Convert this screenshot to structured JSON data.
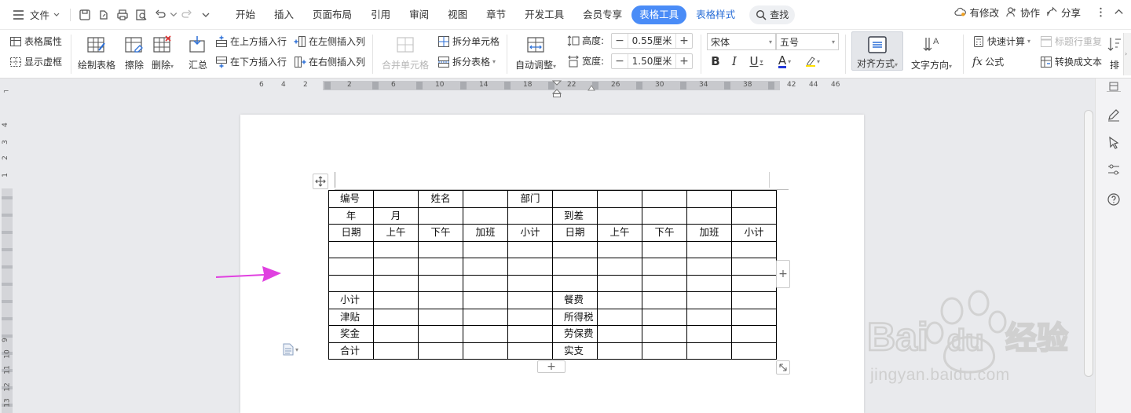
{
  "menubar": {
    "file_label": "文件",
    "tabs": [
      {
        "label": "开始"
      },
      {
        "label": "插入"
      },
      {
        "label": "页面布局"
      },
      {
        "label": "引用"
      },
      {
        "label": "审阅"
      },
      {
        "label": "视图"
      },
      {
        "label": "章节"
      },
      {
        "label": "开发工具"
      },
      {
        "label": "会员专享"
      },
      {
        "label": "表格工具",
        "active": true
      },
      {
        "label": "表格样式"
      }
    ],
    "search_label": "查找",
    "modified_label": "有修改",
    "collab_label": "协作",
    "share_label": "分享"
  },
  "ribbon": {
    "table_props": "表格属性",
    "show_gridlines": "显示虚框",
    "draw_table": "绘制表格",
    "erase": "擦除",
    "delete": "删除",
    "summary": "汇总",
    "insert_row_above": "在上方插入行",
    "insert_row_below": "在下方插入行",
    "insert_col_left": "在左侧插入列",
    "insert_col_right": "在右侧插入列",
    "merge_cells": "合并单元格",
    "split_cells": "拆分单元格",
    "split_table": "拆分表格",
    "auto_fit": "自动调整",
    "height_label": "高度:",
    "height_value": "0.55厘米",
    "width_label": "宽度:",
    "width_value": "1.50厘米",
    "font_name": "宋体",
    "font_size": "五号",
    "align": "对齐方式",
    "text_direction": "文字方向",
    "quick_calc": "快速计算",
    "repeat_header": "标题行重复",
    "formula": "公式",
    "convert_to_text": "转换成文本",
    "more": "排"
  },
  "ruler": {
    "h_numbers": [
      "6",
      "4",
      "2",
      "2",
      "6",
      "10",
      "14",
      "18",
      "22",
      "26",
      "30",
      "34",
      "38",
      "42",
      "44",
      "46"
    ],
    "v_numbers": [
      "4",
      "3",
      "2",
      "1",
      "1",
      "2",
      "9",
      "10",
      "11",
      "12",
      "13"
    ]
  },
  "table": {
    "rows": [
      [
        "编号",
        "",
        "姓名",
        "",
        "部门",
        "",
        "",
        "",
        "",
        ""
      ],
      [
        "年",
        "月",
        "",
        "",
        "",
        "到差",
        "",
        "",
        "",
        ""
      ],
      [
        "日期",
        "上午",
        "下午",
        "加班",
        "小计",
        "日期",
        "上午",
        "下午",
        "加班",
        "小计"
      ],
      [
        "",
        "",
        "",
        "",
        "",
        "",
        "",
        "",
        "",
        ""
      ],
      [
        "",
        "",
        "",
        "",
        "",
        "",
        "",
        "",
        "",
        ""
      ],
      [
        "",
        "",
        "",
        "",
        "",
        "",
        "",
        "",
        "",
        ""
      ],
      [
        "小计",
        "",
        "",
        "",
        "",
        "餐费",
        "",
        "",
        "",
        ""
      ],
      [
        "津贴",
        "",
        "",
        "",
        "",
        "所得税",
        "",
        "",
        "",
        ""
      ],
      [
        "奖金",
        "",
        "",
        "",
        "",
        "劳保费",
        "",
        "",
        "",
        ""
      ],
      [
        "合计",
        "",
        "",
        "",
        "",
        "实支",
        "",
        "",
        "",
        ""
      ]
    ],
    "add_row_symbol": "+",
    "add_col_symbol": "+"
  },
  "watermark": {
    "brand": "Bai du 经验",
    "url": "jingyan.baidu.com"
  },
  "colors": {
    "accent": "#4a8cf7",
    "arrow": "#e040e0",
    "page_bg": "#ffffff",
    "app_bg": "#e9eaed"
  }
}
